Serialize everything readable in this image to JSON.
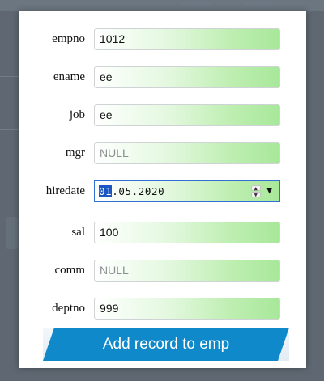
{
  "form": {
    "fields": [
      {
        "label": "empno",
        "value": "1012",
        "placeholder": ""
      },
      {
        "label": "ename",
        "value": "ee",
        "placeholder": ""
      },
      {
        "label": "job",
        "value": "ee",
        "placeholder": ""
      },
      {
        "label": "mgr",
        "value": "",
        "placeholder": "NULL"
      },
      {
        "label": "hiredate",
        "value_selected": "01",
        "value_rest": ".05.2020"
      },
      {
        "label": "sal",
        "value": "100",
        "placeholder": ""
      },
      {
        "label": "comm",
        "value": "",
        "placeholder": "NULL"
      },
      {
        "label": "deptno",
        "value": "999",
        "placeholder": ""
      }
    ],
    "submit_label": "Add record to emp",
    "icons": {
      "spin_up": "▲",
      "spin_down": "▼",
      "dropdown": "▼"
    }
  },
  "colors": {
    "overlay": "#5f6872",
    "field_gradient_end": "#a8e89a",
    "active_border": "#2f6fd6",
    "selection": "#1a56c4",
    "button": "#0f89c9"
  }
}
